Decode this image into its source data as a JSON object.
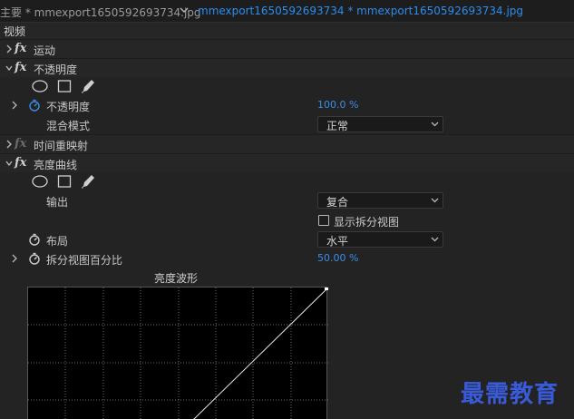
{
  "tabs": {
    "source": "主要 * mmexport1650592693734.jpg",
    "clip": "mmexport1650592693734 * mmexport1650592693734.jpg"
  },
  "section_label": "视频",
  "effects": {
    "motion": {
      "name": "运动"
    },
    "opacity": {
      "name": "不透明度",
      "opacity_label": "不透明度",
      "opacity_value": "100.0 %",
      "blend_label": "混合模式",
      "blend_value": "正常"
    },
    "time_remap": {
      "name": "时间重映射"
    },
    "lumetri_curves": {
      "name": "亮度曲线",
      "output_label": "输出",
      "output_value": "复合",
      "split_view_label": "显示拆分视图",
      "split_view_checked": false,
      "layout_label": "布局",
      "layout_value": "水平",
      "split_percent_label": "拆分视图百分比",
      "split_percent_value": "50.00 %",
      "graph_title": "亮度波形"
    }
  },
  "watermark": "最需教育",
  "colors": {
    "accent_blue": "#3a8de6",
    "tab_blue": "#2d8ceb",
    "watermark_blue": "#3a5bd9",
    "panel_bg": "#232323"
  }
}
